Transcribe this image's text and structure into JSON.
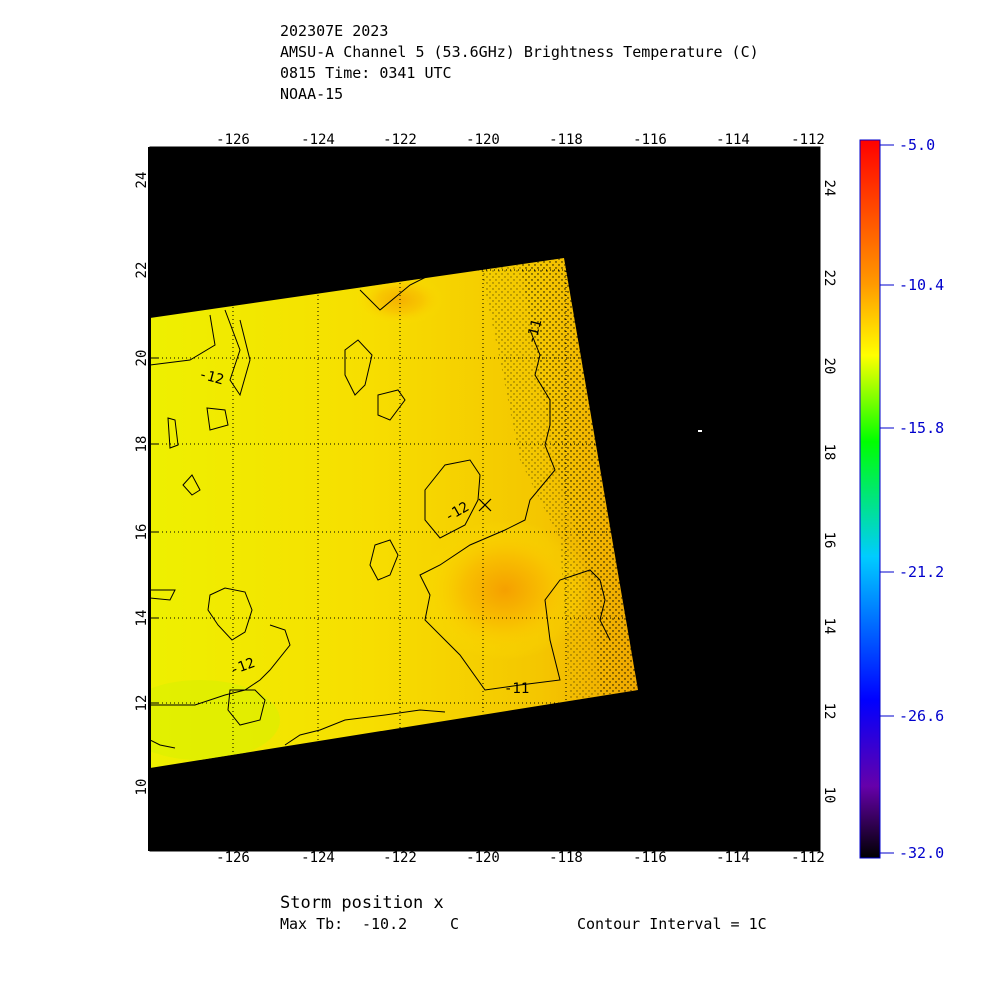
{
  "header": {
    "line1": "202307E 2023",
    "line2": "AMSU-A Channel 5 (53.6GHz) Brightness Temperature (C)",
    "line3": "0815 Time: 0341 UTC",
    "line4": "NOAA-15"
  },
  "axes": {
    "lon_labels": [
      "-126",
      "-124",
      "-122",
      "-120",
      "-118",
      "-116",
      "-114",
      "-112"
    ],
    "lat_labels": [
      "10",
      "12",
      "14",
      "16",
      "18",
      "20",
      "22",
      "24"
    ]
  },
  "contour_labels": [
    "-12",
    "-12",
    "-12",
    "-11",
    "-11"
  ],
  "storm_marker": "x",
  "colorbar": {
    "labels": [
      "-5.0",
      "-10.4",
      "-15.8",
      "-21.2",
      "-26.6",
      "-32.0"
    ]
  },
  "footer": {
    "storm_position": "Storm position x",
    "max_tb_label": "Max Tb:",
    "max_tb_value": "-10.2",
    "max_tb_unit": "C",
    "contour_interval": "Contour Interval = 1C"
  },
  "colors": {
    "background": "#000000",
    "warm": "#ff0000",
    "mid": "#ffff00",
    "cold": "#000000"
  }
}
